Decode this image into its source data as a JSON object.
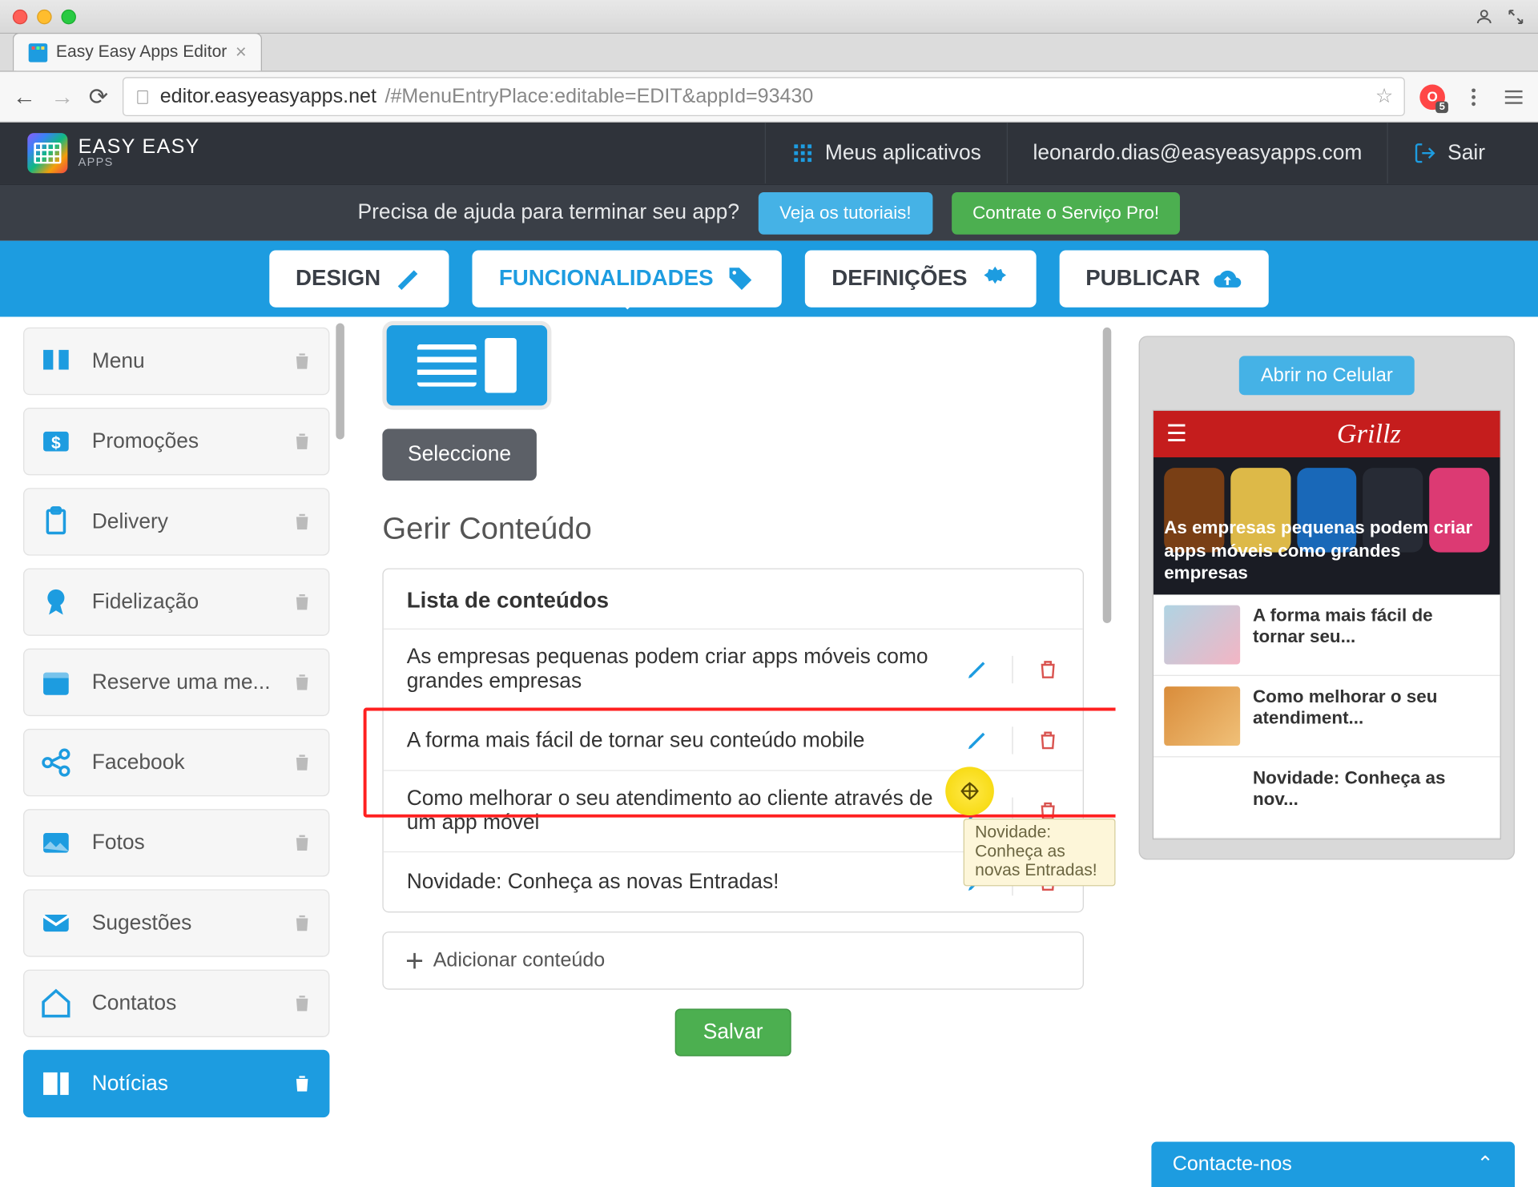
{
  "browser": {
    "tab_title": "Easy Easy Apps Editor",
    "url_host": "editor.easyeasyapps.net",
    "url_path": "/#MenuEntryPlace:editable=EDIT&appId=93430"
  },
  "header": {
    "brand_top": "EASY EASY",
    "brand_sub": "APPS",
    "my_apps": "Meus aplicativos",
    "user_email": "leonardo.dias@easyeasyapps.com",
    "sign_out": "Sair"
  },
  "help": {
    "prompt": "Precisa de ajuda para terminar seu app?",
    "tutorials": "Veja os tutoriais!",
    "pro": "Contrate o Serviço Pro!"
  },
  "nav": {
    "design": "DESIGN",
    "funcionalidades": "FUNCIONALIDADES",
    "definicoes": "DEFINIÇÕES",
    "publicar": "PUBLICAR"
  },
  "sidebar": {
    "items": [
      {
        "label": "Menu"
      },
      {
        "label": "Promoções"
      },
      {
        "label": "Delivery"
      },
      {
        "label": "Fidelização"
      },
      {
        "label": "Reserve uma me..."
      },
      {
        "label": "Facebook"
      },
      {
        "label": "Fotos"
      },
      {
        "label": "Sugestões"
      },
      {
        "label": "Contatos"
      },
      {
        "label": "Notícias"
      }
    ]
  },
  "center": {
    "select_btn": "Seleccione",
    "section_title": "Gerir Conteúdo",
    "list_heading": "Lista de conteúdos",
    "rows": [
      "As empresas pequenas podem criar apps móveis como grandes empresas",
      "A forma mais fácil de tornar seu conteúdo mobile",
      "Como melhorar o seu atendimento ao cliente através de um app móvel",
      "Novidade: Conheça as novas Entradas!"
    ],
    "add_content": "Adicionar conteúdo",
    "save": "Salvar",
    "tooltip": "Novidade: Conheça as novas Entradas!"
  },
  "preview": {
    "open": "Abrir no Celular",
    "brand": "Grillz",
    "hero": "As empresas pequenas podem criar apps móveis como grandes empresas",
    "news": [
      "A forma mais fácil de tornar seu...",
      "Como melhorar o seu atendiment...",
      "Novidade: Conheça as nov..."
    ]
  },
  "contact": "Contacte-nos"
}
